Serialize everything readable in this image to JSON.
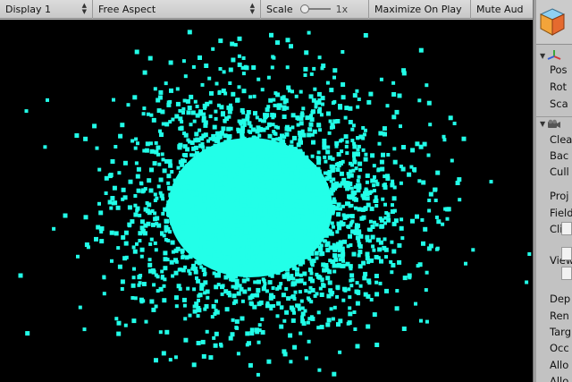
{
  "toolbar": {
    "display_label": "Display 1",
    "aspect_label": "Free Aspect",
    "scale_label": "Scale",
    "scale_value": "1x",
    "scale_slider_fraction": 0,
    "maximize_label": "Maximize On Play",
    "mute_label": "Mute Aud"
  },
  "viewport": {
    "background_color": "#000000",
    "particle_color": "#22ffe8"
  },
  "inspector": {
    "header_icon": "gameobject-cube-icon",
    "transform": {
      "icon": "transform-axes-icon",
      "props": [
        "Pos",
        "Rot",
        "Sca"
      ]
    },
    "camera": {
      "icon": "camera-icon",
      "props": [
        "Clea",
        "Bac",
        "Cull",
        "Proj",
        "Field",
        "Clip",
        "View",
        "Dep",
        "Ren",
        "Targ",
        "Occ",
        "Allo",
        "Allo"
      ]
    }
  }
}
